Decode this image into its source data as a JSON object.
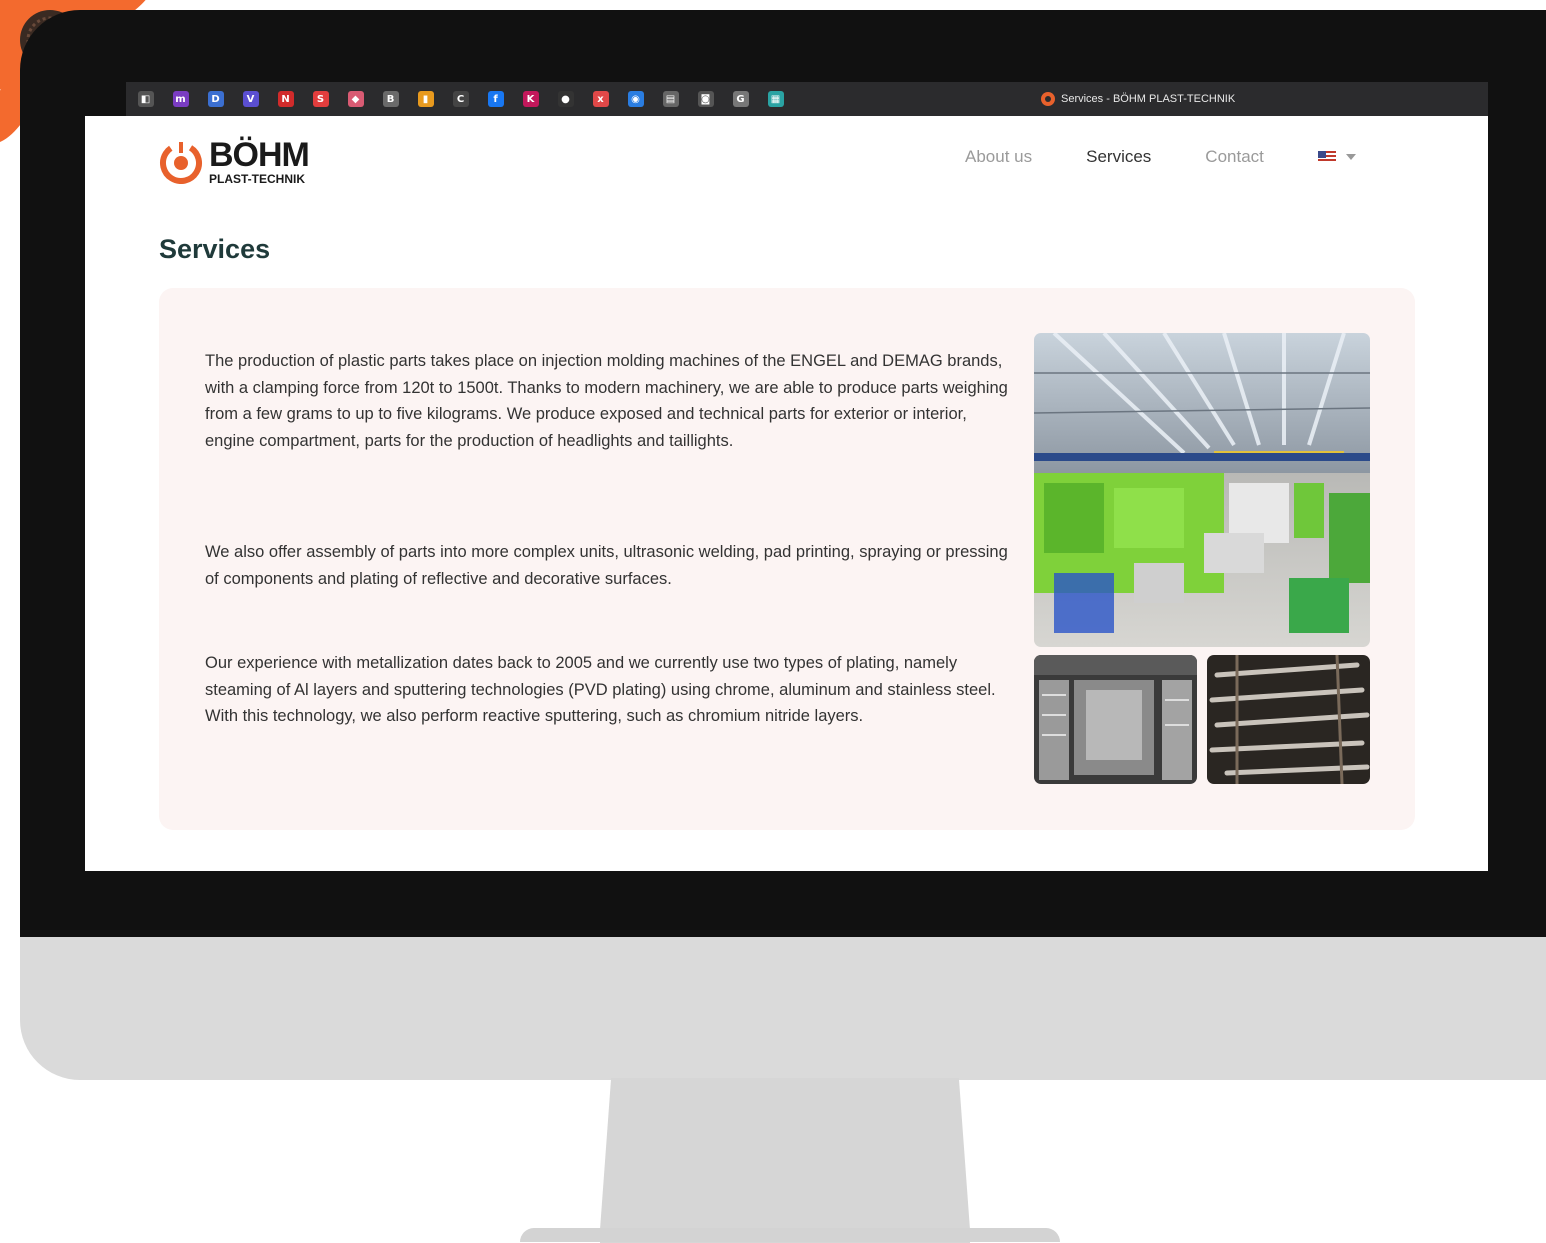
{
  "browser": {
    "tab_title": "Services - BÖHM PLAST-TECHNIK",
    "favicons": [
      {
        "icon": "bookmark-icon",
        "color": "#555",
        "glyph": "◧"
      },
      {
        "icon": "m-icon",
        "color": "#7a3cc2",
        "glyph": "m"
      },
      {
        "icon": "d-icon",
        "color": "#3b6fd1",
        "glyph": "D"
      },
      {
        "icon": "v-icon",
        "color": "#5b4fd1",
        "glyph": "V"
      },
      {
        "icon": "n-icon",
        "color": "#d12b2b",
        "glyph": "N"
      },
      {
        "icon": "s-icon",
        "color": "#e23d3d",
        "glyph": "S"
      },
      {
        "icon": "shield-icon",
        "color": "#d95b73",
        "glyph": "◆"
      },
      {
        "icon": "b-icon",
        "color": "#6a6a6a",
        "glyph": "B"
      },
      {
        "icon": "bookmark-orange-icon",
        "color": "#e89a1e",
        "glyph": "▮"
      },
      {
        "icon": "c-icon",
        "color": "#444",
        "glyph": "C"
      },
      {
        "icon": "facebook-icon",
        "color": "#1877f2",
        "glyph": "f"
      },
      {
        "icon": "k-icon",
        "color": "#c2185b",
        "glyph": "K"
      },
      {
        "icon": "circle-icon",
        "color": "#333",
        "glyph": "●"
      },
      {
        "icon": "x-circle-icon",
        "color": "#e04848",
        "glyph": "x"
      },
      {
        "icon": "globe-icon",
        "color": "#2a7de1",
        "glyph": "◉"
      },
      {
        "icon": "calendar-icon",
        "color": "#666",
        "glyph": "▤"
      },
      {
        "icon": "camera-icon",
        "color": "#555",
        "glyph": "◙"
      },
      {
        "icon": "g-icon",
        "color": "#777",
        "glyph": "G"
      },
      {
        "icon": "teams-icon",
        "color": "#2aa3a3",
        "glyph": "▦"
      }
    ]
  },
  "site": {
    "logo_main": "BÖHM",
    "logo_sub": "PLAST-TECHNIK",
    "nav": [
      {
        "label": "About us",
        "active": false
      },
      {
        "label": "Services",
        "active": true
      },
      {
        "label": "Contact",
        "active": false
      }
    ],
    "language": "EN"
  },
  "page": {
    "title": "Services",
    "paragraphs": [
      "The production of plastic parts takes place on injection molding machines of the ENGEL and DEMAG brands, with a clamping force from 120t to 1500t. Thanks to modern machinery, we are able to produce parts weighing from a few grams to up to five kilograms. We produce exposed and technical parts for exterior or interior, engine compartment, parts for the production of headlights and taillights.",
      "We also offer assembly of parts into more complex units, ultrasonic welding, pad printing, spraying or pressing of components and plating of reflective and decorative surfaces.",
      "Our experience with metallization dates back to 2005 and we currently use two types of plating, namely steaming of Al layers and sputtering technologies (PVD plating) using chrome, aluminum and stainless steel. With this technology, we also perform reactive sputtering, such as chromium nitride layers."
    ]
  },
  "colors": {
    "accent": "#e8612c",
    "card_bg": "#fcf4f3",
    "title": "#1f3a3a"
  }
}
